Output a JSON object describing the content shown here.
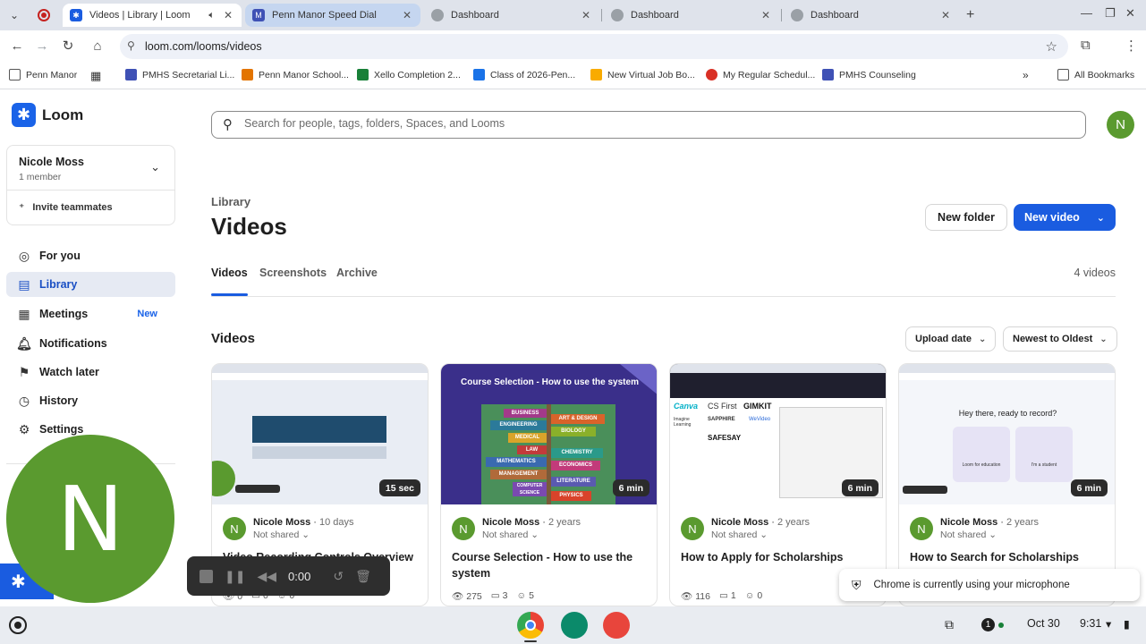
{
  "browser": {
    "tabs": [
      {
        "title": "Videos | Library | Loom",
        "state": "active"
      },
      {
        "title": "Penn Manor Speed Dial",
        "state": "hover"
      },
      {
        "title": "Dashboard",
        "state": "normal"
      },
      {
        "title": "Dashboard",
        "state": "normal"
      },
      {
        "title": "Dashboard",
        "state": "normal"
      }
    ],
    "url": "loom.com/looms/videos",
    "bookmarks": [
      {
        "label": "Penn Manor",
        "color": "#555555"
      },
      {
        "label": "PMHS Secretarial Li...",
        "color": "#3f51b5"
      },
      {
        "label": "Penn Manor School...",
        "color": "#e37400"
      },
      {
        "label": "Xello Completion 2...",
        "color": "#188038"
      },
      {
        "label": "Class of 2026-Pen...",
        "color": "#1a73e8"
      },
      {
        "label": "New Virtual Job Bo...",
        "color": "#f9ab00"
      },
      {
        "label": "My Regular Schedul...",
        "color": "#d93025"
      },
      {
        "label": "PMHS Counseling",
        "color": "#3f51b5"
      }
    ],
    "all_bookmarks": "All Bookmarks"
  },
  "app": {
    "name": "Loom",
    "brand_color": "#1a5ce0"
  },
  "workspace": {
    "name": "Nicole Moss",
    "members": "1 member",
    "invite": "Invite teammates"
  },
  "nav": [
    {
      "label": "For you",
      "icon": "person-circle-icon",
      "glyph": "◎"
    },
    {
      "label": "Library",
      "icon": "library-icon",
      "glyph": "▤",
      "active": true
    },
    {
      "label": "Meetings",
      "icon": "meetings-icon",
      "glyph": "▦",
      "badge": "New"
    },
    {
      "label": "Notifications",
      "icon": "bell-icon",
      "glyph": "♫"
    },
    {
      "label": "Watch later",
      "icon": "bookmark-icon",
      "glyph": "⚑"
    },
    {
      "label": "History",
      "icon": "history-icon",
      "glyph": "◷"
    },
    {
      "label": "Settings",
      "icon": "gear-icon",
      "glyph": "⚙"
    }
  ],
  "search": {
    "placeholder": "Search for people, tags, folders, Spaces, and Looms"
  },
  "user_initial": "N",
  "page": {
    "breadcrumb": "Library",
    "title": "Videos",
    "new_folder": "New folder",
    "new_video": "New video",
    "tabs": [
      "Videos",
      "Screenshots",
      "Archive"
    ],
    "count": "4 videos",
    "section_title": "Videos",
    "sort_field": "Upload date",
    "sort_order": "Newest to Oldest"
  },
  "videos": [
    {
      "duration": "15 sec",
      "author": "Nicole Moss",
      "ago": "10 days",
      "sharing": "Not shared",
      "title": "Video Recording Controls Overview",
      "views": "0",
      "comments": "0",
      "reactions": "0"
    },
    {
      "duration": "6 min",
      "author": "Nicole Moss",
      "ago": "2 years",
      "sharing": "Not shared",
      "title": "Course Selection - How to use the system",
      "views": "275",
      "comments": "3",
      "reactions": "5",
      "thumb_title": "Course Selection - How to use the system",
      "signs": [
        "BUSINESS",
        "ENGINEERING",
        "MEDICAL",
        "LAW",
        "MATHEMATICS",
        "MANAGEMENT",
        "COMPUTER SCIENCE",
        "ART & DESIGN",
        "BIOLOGY",
        "CHEMISTRY",
        "ECONOMICS",
        "LITERATURE",
        "PHYSICS"
      ]
    },
    {
      "duration": "6 min",
      "author": "Nicole Moss",
      "ago": "2 years",
      "sharing": "Not shared",
      "title": "How to Apply for Scholarships",
      "views": "116",
      "comments": "1",
      "reactions": "0",
      "thumb_logos": [
        "Canva",
        "CS First",
        "GIMKIT",
        "SAPPHIRE",
        "WeVideo",
        "Imagine Learning",
        "SAFESAY"
      ]
    },
    {
      "duration": "6 min",
      "author": "Nicole Moss",
      "ago": "2 years",
      "sharing": "Not shared",
      "title": "How to Search for Scholarships",
      "thumb_prompt": "Hey there, ready to record?",
      "thumb_options": [
        "Loom for education",
        "I'm a student"
      ]
    }
  ],
  "recorder": {
    "time": "0:00",
    "camera_initial": "N"
  },
  "toast": "Chrome is currently using your microphone",
  "shelf": {
    "notifications": "1",
    "date": "Oct 30",
    "time": "9:31"
  }
}
